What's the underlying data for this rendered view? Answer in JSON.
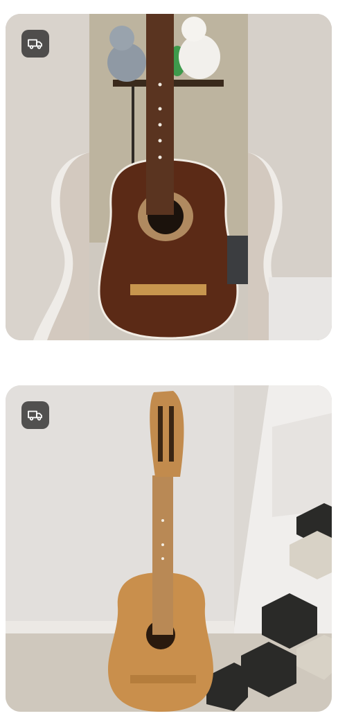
{
  "listings": [
    {
      "photo": "acoustic-guitar-dark-brown-photo",
      "badge_icon": "delivery-truck-icon"
    },
    {
      "photo": "acoustic-guitar-natural-wood-photo",
      "badge_icon": "delivery-truck-icon"
    }
  ]
}
